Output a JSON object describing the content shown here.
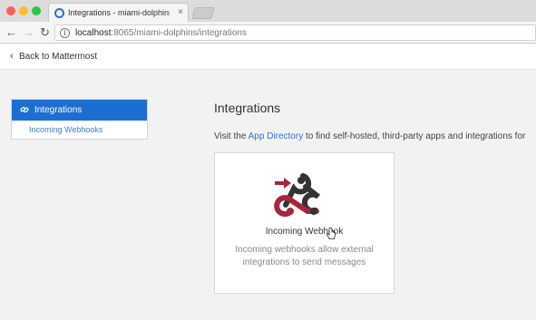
{
  "browser": {
    "tab_title": "Integrations - miami-dolphins",
    "tab_close": "×",
    "url_host": "localhost",
    "url_rest": ":8065/miami-dolphins/integrations",
    "info": "i",
    "nav": {
      "back": "←",
      "forward": "→",
      "reload": "↻"
    }
  },
  "header": {
    "back_chevron": "‹",
    "back_label": "Back to Mattermost"
  },
  "sidebar": {
    "title": "Integrations",
    "items": [
      {
        "label": "Incoming Webhooks"
      }
    ]
  },
  "main": {
    "title": "Integrations",
    "intro_before": "Visit the ",
    "intro_link": "App Directory",
    "intro_after": " to find self-hosted, third-party apps and integrations for",
    "cards": [
      {
        "title": "Incoming Webhook",
        "description": "Incoming webhooks allow external integrations to send messages"
      }
    ]
  },
  "colors": {
    "accent": "#1c6fd1",
    "link": "#2a75d6",
    "webhook_red": "#a6263e",
    "webhook_dark": "#333333"
  }
}
